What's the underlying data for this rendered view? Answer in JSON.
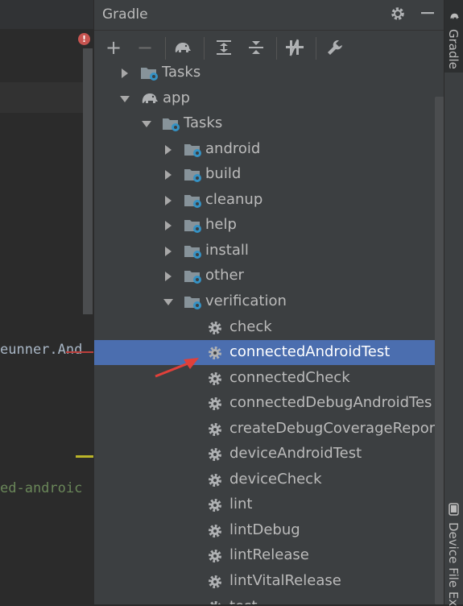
{
  "editor": {
    "line1": "eunner.And",
    "line2": "ed-androic",
    "error_glyph": "!"
  },
  "gradle": {
    "title": "Gradle",
    "toolbar": {
      "add": "+",
      "remove": "−"
    },
    "tree": [
      {
        "label": "Tasks",
        "kind": "folder",
        "expanded": false
      },
      {
        "label": "app",
        "kind": "project",
        "expanded": true
      },
      {
        "label": "Tasks",
        "kind": "folder",
        "expanded": true
      },
      {
        "label": "android",
        "kind": "folder",
        "expanded": false
      },
      {
        "label": "build",
        "kind": "folder",
        "expanded": false
      },
      {
        "label": "cleanup",
        "kind": "folder",
        "expanded": false
      },
      {
        "label": "help",
        "kind": "folder",
        "expanded": false
      },
      {
        "label": "install",
        "kind": "folder",
        "expanded": false
      },
      {
        "label": "other",
        "kind": "folder",
        "expanded": false
      },
      {
        "label": "verification",
        "kind": "folder",
        "expanded": true
      },
      {
        "label": "check",
        "kind": "task"
      },
      {
        "label": "connectedAndroidTest",
        "kind": "task",
        "selected": true
      },
      {
        "label": "connectedCheck",
        "kind": "task"
      },
      {
        "label": "connectedDebugAndroidTes",
        "kind": "task"
      },
      {
        "label": "createDebugCoverageRepor",
        "kind": "task"
      },
      {
        "label": "deviceAndroidTest",
        "kind": "task"
      },
      {
        "label": "deviceCheck",
        "kind": "task"
      },
      {
        "label": "lint",
        "kind": "task"
      },
      {
        "label": "lintDebug",
        "kind": "task"
      },
      {
        "label": "lintRelease",
        "kind": "task"
      },
      {
        "label": "lintVitalRelease",
        "kind": "task"
      },
      {
        "label": "test",
        "kind": "task"
      }
    ]
  },
  "side_tabs": {
    "gradle": "Gradle",
    "device_file": "Device File Ex"
  },
  "colors": {
    "selection": "#4b6eaf",
    "gear": "#afb1b3",
    "folder_badge": "#3592c4",
    "annotation_arrow": "#e0403a"
  }
}
